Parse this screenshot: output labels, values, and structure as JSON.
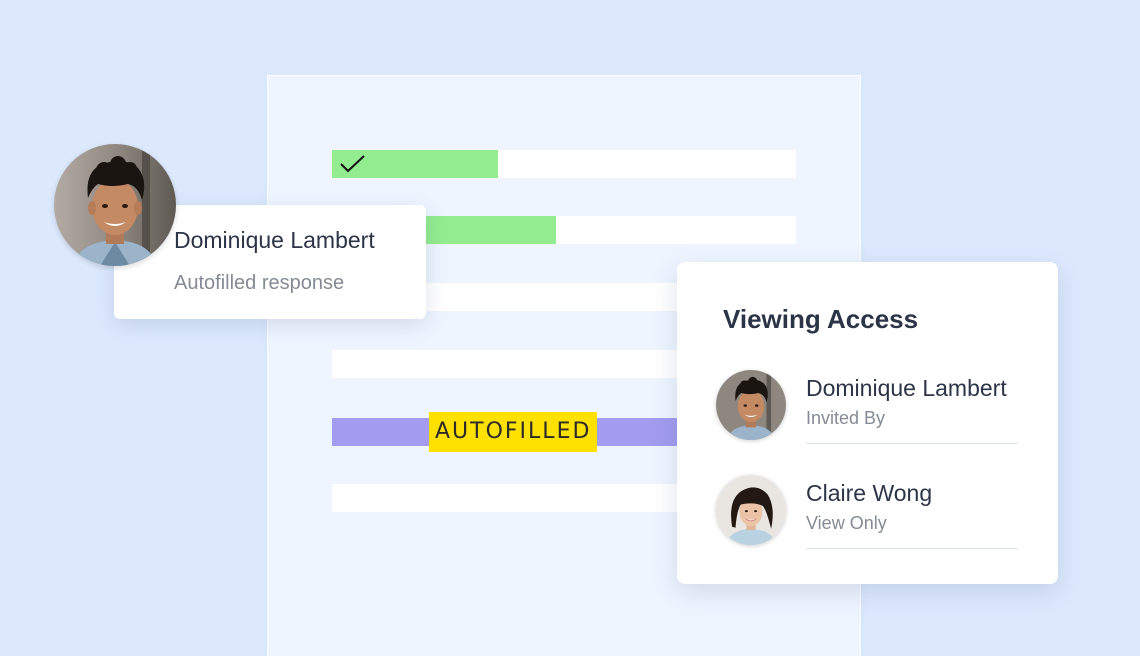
{
  "colors": {
    "background": "#dce9fd",
    "document": "#eef5ff",
    "done_fill": "#93ec8f",
    "autofill_fill": "#a29bf0",
    "tag_highlight": "#ffe100"
  },
  "document": {
    "tag_label": "AUTOFILLED",
    "lines": [
      {
        "fill_fraction": 0.36,
        "color": "#93ec8f",
        "checked": true
      },
      {
        "fill_fraction": 0.48,
        "color": "#93ec8f",
        "checked": false
      },
      {
        "fill_fraction": 0,
        "color": null,
        "checked": false
      },
      {
        "fill_fraction": 0,
        "color": null,
        "checked": false
      },
      {
        "fill_fraction": 1,
        "color": "#a29bf0",
        "checked": false
      },
      {
        "fill_fraction": 0,
        "color": null,
        "checked": false
      }
    ]
  },
  "response_card": {
    "name": "Dominique Lambert",
    "subtitle": "Autofilled response",
    "avatar_icon": "user-avatar-man"
  },
  "access_card": {
    "title": "Viewing Access",
    "people": [
      {
        "name": "Dominique Lambert",
        "role": "Invited By",
        "avatar_icon": "user-avatar-man"
      },
      {
        "name": "Claire Wong",
        "role": "View Only",
        "avatar_icon": "user-avatar-woman"
      }
    ]
  }
}
